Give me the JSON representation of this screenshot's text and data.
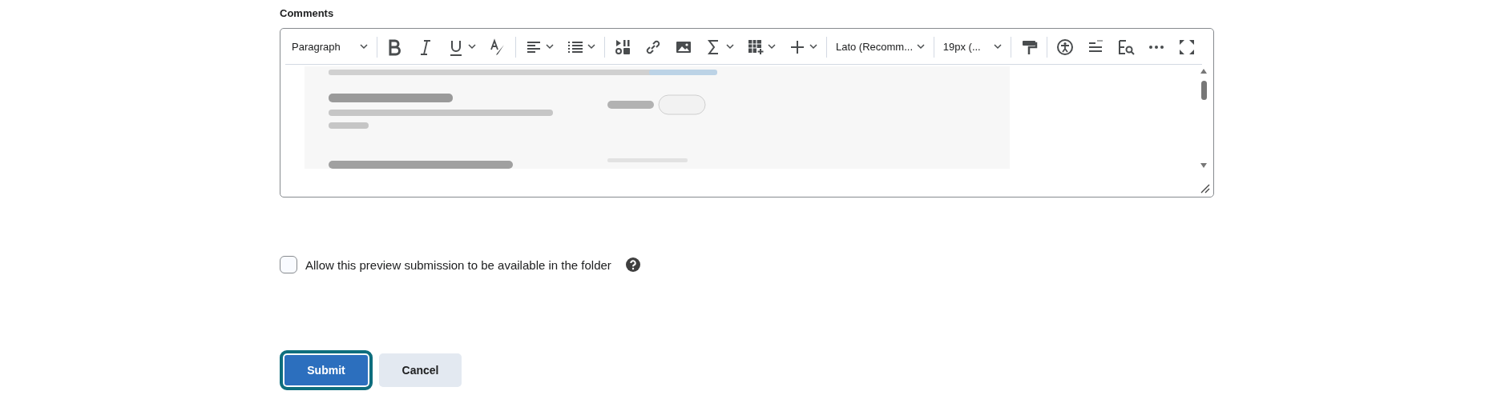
{
  "comments": {
    "label": "Comments",
    "toolbar": [
      {
        "kind": "dropdown",
        "label": "Paragraph"
      },
      {
        "kind": "separator"
      },
      {
        "kind": "button",
        "has_menu": false
      },
      {
        "kind": "button",
        "has_menu": false
      },
      {
        "kind": "button",
        "has_menu": true
      },
      {
        "kind": "button",
        "has_menu": false
      },
      {
        "kind": "separator"
      },
      {
        "kind": "button",
        "has_menu": true
      },
      {
        "kind": "button",
        "has_menu": true
      },
      {
        "kind": "separator"
      },
      {
        "kind": "button",
        "has_menu": false
      },
      {
        "kind": "button",
        "has_menu": false
      },
      {
        "kind": "button",
        "has_menu": false
      },
      {
        "kind": "button",
        "has_menu": true
      },
      {
        "kind": "button",
        "has_menu": true
      },
      {
        "kind": "button",
        "has_menu": true
      },
      {
        "kind": "separator"
      },
      {
        "kind": "dropdown",
        "label": "Lato (Recomm..."
      },
      {
        "kind": "separator"
      },
      {
        "kind": "dropdown",
        "label": "19px (..."
      },
      {
        "kind": "separator"
      },
      {
        "kind": "button",
        "has_menu": false
      },
      {
        "kind": "separator"
      },
      {
        "kind": "button",
        "has_menu": false
      },
      {
        "kind": "button",
        "has_menu": false
      },
      {
        "kind": "button",
        "has_menu": false
      },
      {
        "kind": "spacer"
      },
      {
        "kind": "button",
        "has_menu": false
      },
      {
        "kind": "button",
        "has_menu": false
      }
    ]
  },
  "allow_preview": {
    "label": "Allow this preview submission to be available in the folder",
    "checked": false
  },
  "buttons": [
    {
      "label": "Submit",
      "primary": true,
      "focused": true
    },
    {
      "label": "Cancel",
      "primary": false,
      "focused": false
    }
  ]
}
